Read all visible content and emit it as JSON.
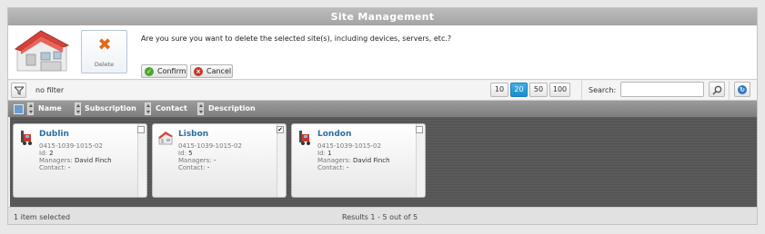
{
  "window": {
    "title": "Site Management"
  },
  "confirm": {
    "action_label": "Delete",
    "message": "Are you sure you want to delete the selected site(s), including devices, servers, etc.?",
    "confirm_label": "Confirm",
    "cancel_label": "Cancel"
  },
  "toolbar": {
    "filter_text": "no filter",
    "page_sizes": [
      "10",
      "20",
      "50",
      "100"
    ],
    "active_page_size": "20",
    "search_label": "Search:",
    "search_value": ""
  },
  "columns": [
    "Name",
    "Subscription",
    "Contact",
    "Description"
  ],
  "cards": [
    {
      "name": "Dublin",
      "code": "0415-1039-1015-02",
      "id_label": "Id:",
      "id": "2",
      "managers_label": "Managers:",
      "managers": "David Finch",
      "contact_label": "Contact:",
      "contact": "-",
      "checked": false,
      "icon": "forklift-icon"
    },
    {
      "name": "Lisbon",
      "code": "0415-1039-1015-02",
      "id_label": "Id:",
      "id": "5",
      "managers_label": "Managers:",
      "managers": "-",
      "contact_label": "Contact:",
      "contact": "-",
      "checked": true,
      "icon": "building-icon"
    },
    {
      "name": "London",
      "code": "0415-1039-1015-02",
      "id_label": "Id:",
      "id": "1",
      "managers_label": "Managers:",
      "managers": "David Finch",
      "contact_label": "Contact:",
      "contact": "-",
      "checked": false,
      "icon": "forklift-icon"
    }
  ],
  "status": {
    "selected": "1 item selected",
    "results": "Results 1 - 5 out of 5"
  },
  "colors": {
    "accent": "#1a8ccc",
    "link": "#2b6f9f",
    "delete": "#e06a1c"
  }
}
